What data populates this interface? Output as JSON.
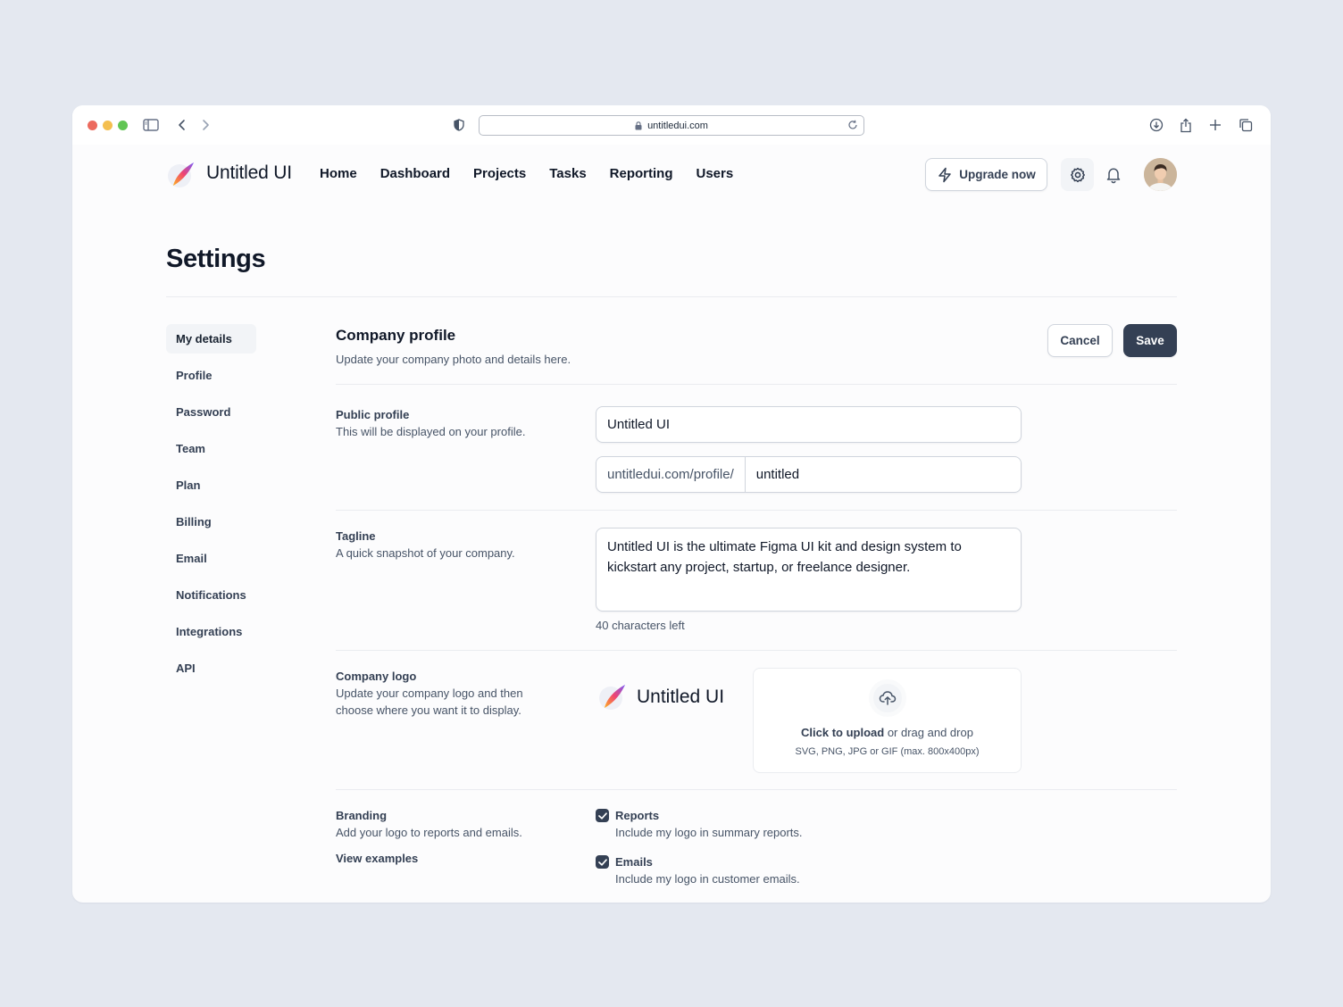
{
  "browser": {
    "url": "untitledui.com"
  },
  "header": {
    "brand": "Untitled UI",
    "nav": [
      "Home",
      "Dashboard",
      "Projects",
      "Tasks",
      "Reporting",
      "Users"
    ],
    "upgrade_label": "Upgrade now"
  },
  "page": {
    "title": "Settings"
  },
  "sidenav": {
    "items": [
      "My details",
      "Profile",
      "Password",
      "Team",
      "Plan",
      "Billing",
      "Email",
      "Notifications",
      "Integrations",
      "API"
    ],
    "active": "My details"
  },
  "section": {
    "title": "Company profile",
    "subtitle": "Update your company photo and details here.",
    "cancel_label": "Cancel",
    "save_label": "Save"
  },
  "public_profile": {
    "label": "Public profile",
    "help": "This will be displayed on your profile.",
    "name_value": "Untitled UI",
    "url_prefix": "untitledui.com/profile/",
    "url_value": "untitled"
  },
  "tagline": {
    "label": "Tagline",
    "help": "A quick snapshot of your company.",
    "value": "Untitled UI is the ultimate Figma UI kit and design system to kickstart any project, startup, or freelance designer.",
    "hint": "40 characters left"
  },
  "company_logo": {
    "label": "Company logo",
    "help": "Update your company logo and then choose where you want it to display.",
    "preview_text": "Untitled UI",
    "upload_action": "Click to upload",
    "upload_rest": " or drag and drop",
    "upload_formats": "SVG, PNG, JPG or GIF (max. 800x400px)"
  },
  "branding": {
    "label": "Branding",
    "help": "Add your logo to reports and emails.",
    "view_examples": "View examples",
    "options": [
      {
        "label": "Reports",
        "help": "Include my logo in summary reports.",
        "checked": true
      },
      {
        "label": "Emails",
        "help": "Include my logo in customer emails.",
        "checked": true
      }
    ]
  },
  "colors": {
    "primary_button": "#344054",
    "background": "#e4e8f0"
  }
}
